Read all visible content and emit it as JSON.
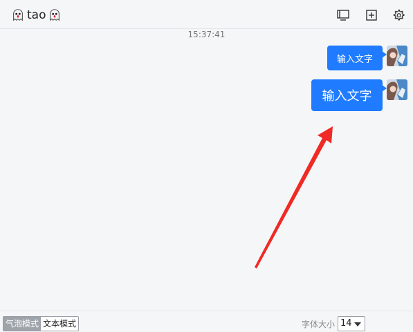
{
  "header": {
    "title": "tao",
    "title_icon": "ghost-emoji",
    "buttons": [
      {
        "name": "screen-icon"
      },
      {
        "name": "add-window-icon"
      },
      {
        "name": "settings-gear-icon"
      }
    ]
  },
  "chat": {
    "timestamp": "15:37:41",
    "messages": [
      {
        "text": "输入文字",
        "font_size": 12
      },
      {
        "text": "输入文字",
        "font_size": 17
      }
    ],
    "bubble_color": "#1f7bff"
  },
  "annotation": {
    "arrow_color": "#f02a24"
  },
  "footer": {
    "modes": [
      {
        "label": "气泡模式",
        "active": true
      },
      {
        "label": "文本模式",
        "active": false
      }
    ],
    "font_size_label": "字体大小",
    "font_size_value": "14"
  }
}
